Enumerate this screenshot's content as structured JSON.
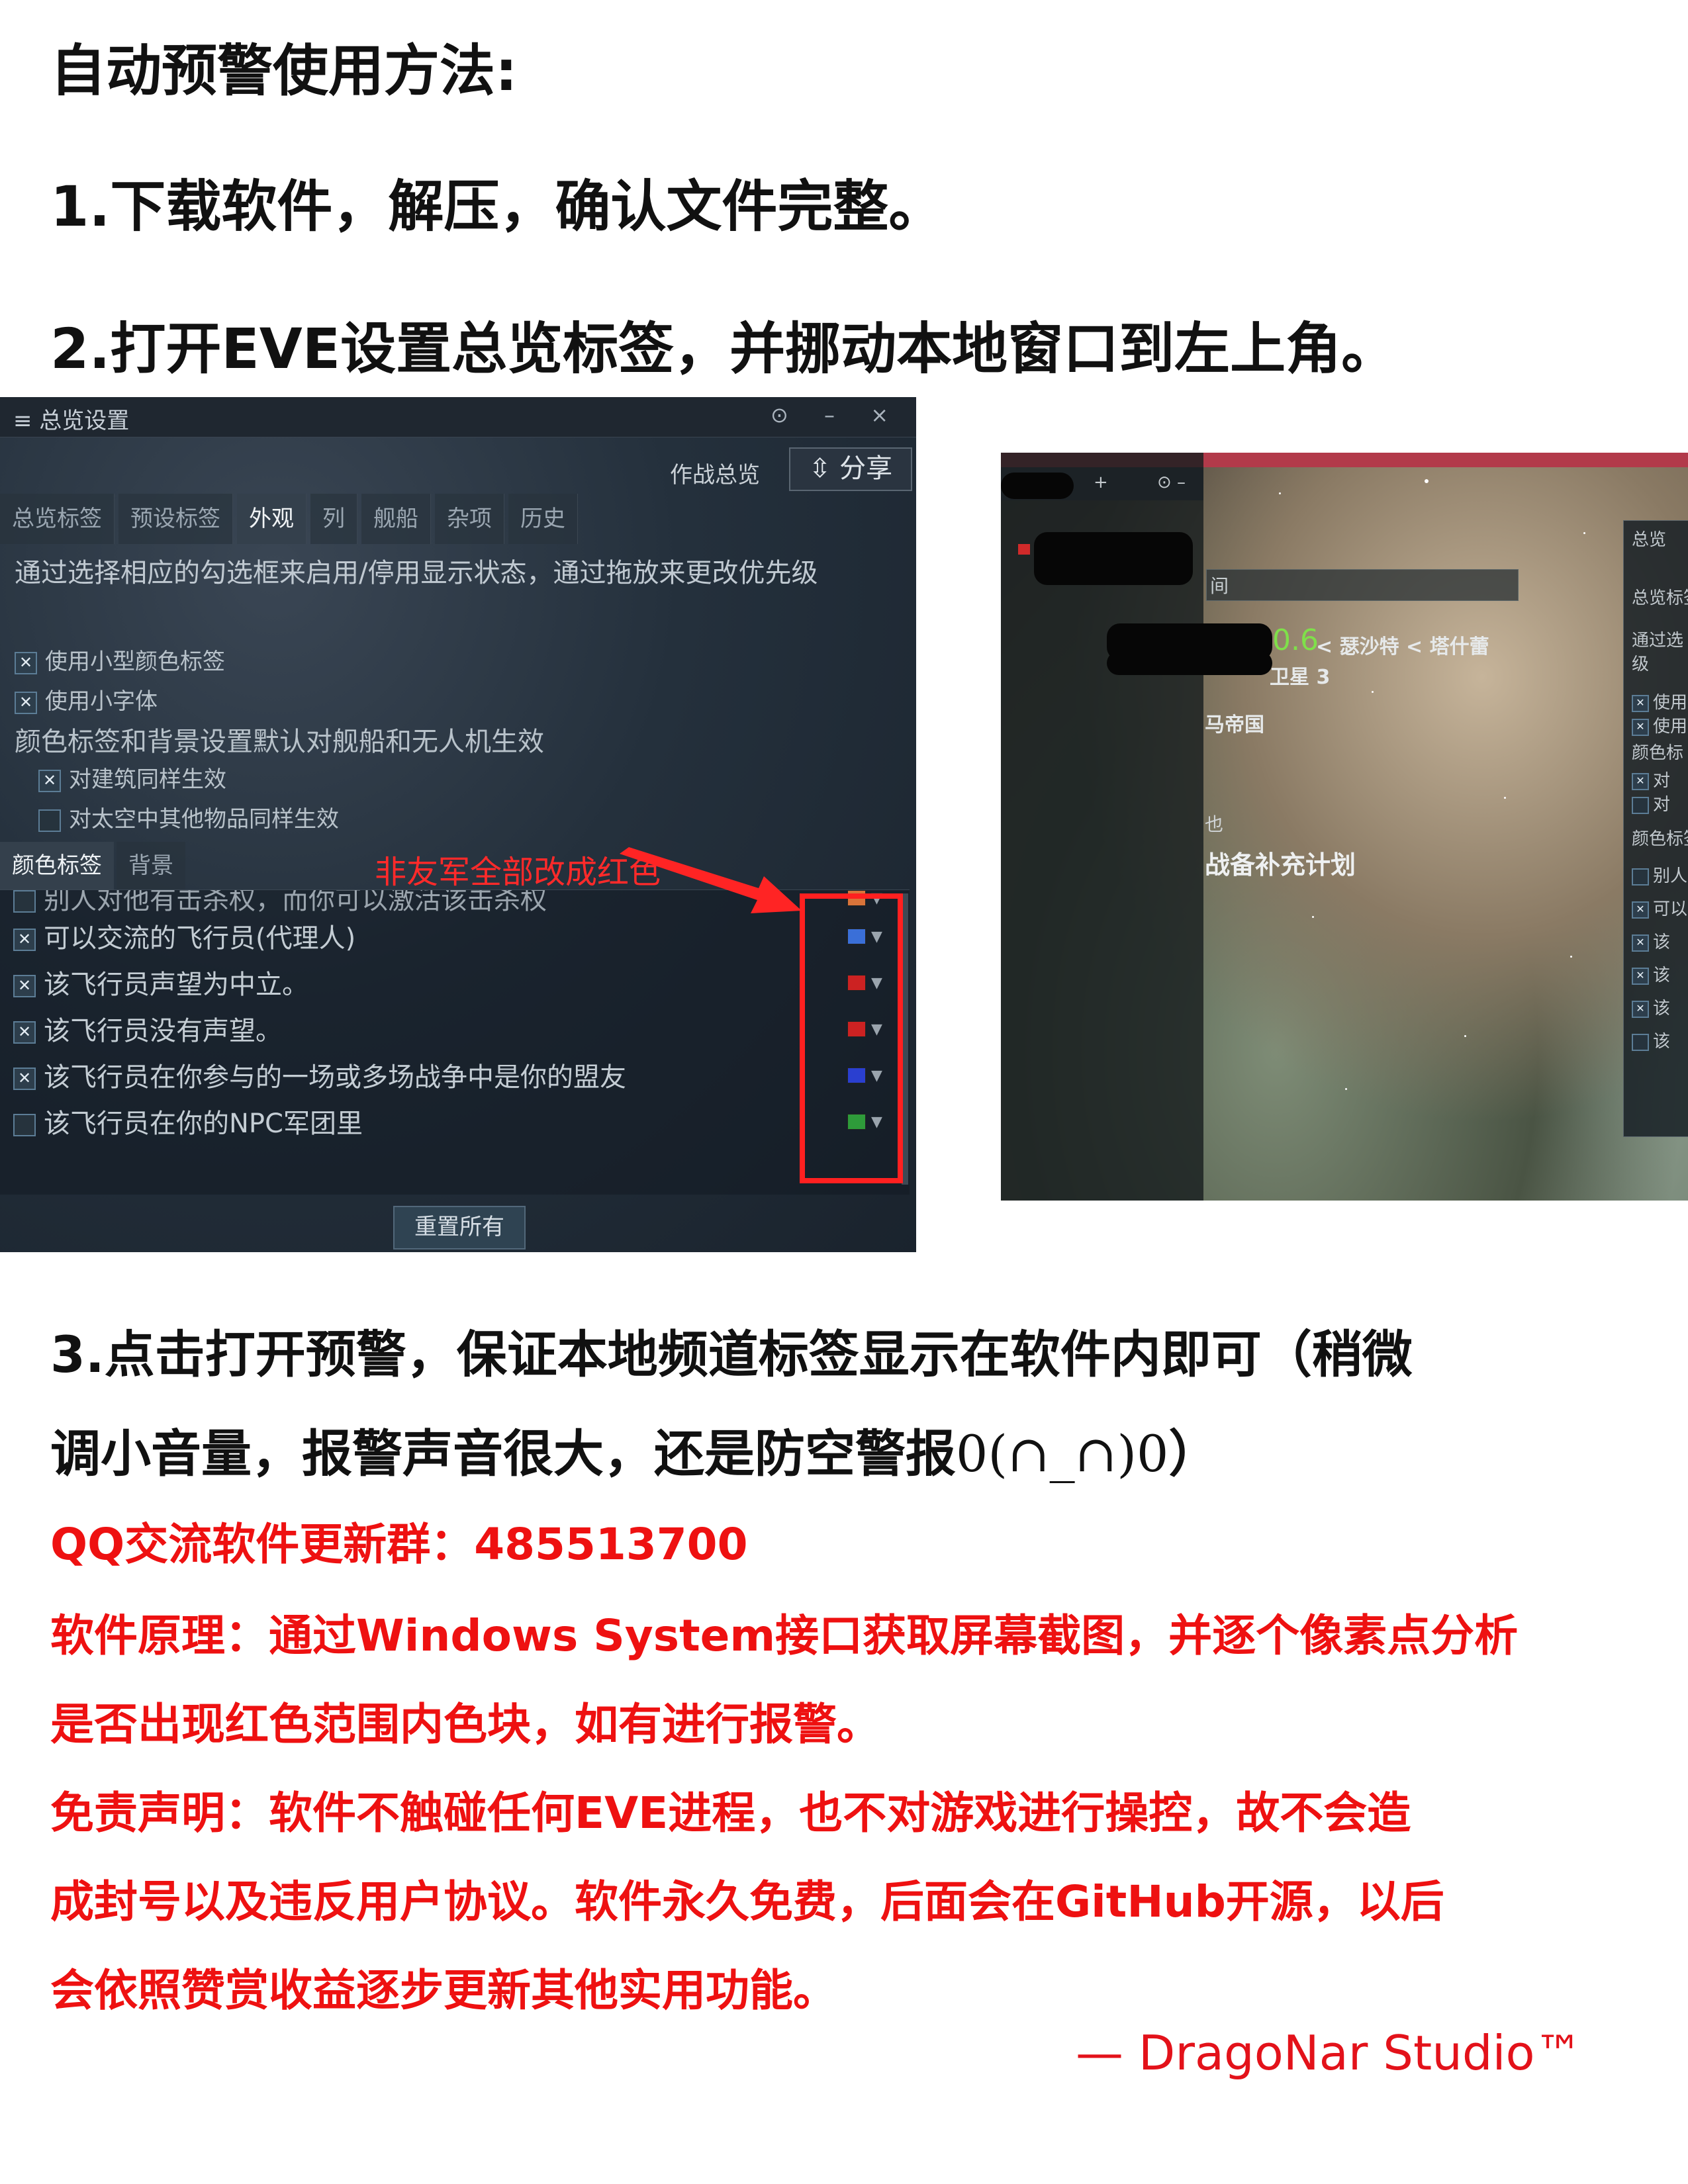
{
  "headings": {
    "title": "自动预警使用方法:",
    "step1": "1.下载软件，解压，确认文件完整。",
    "step2": "2.打开EVE设置总览标签，并挪动本地窗口到左上角。",
    "step3_line1": "3.点击打开预警，保证本地频道标签显示在软件内即可（稍微",
    "step3_line2": "调小音量，报警声音很大，还是防空警报",
    "step3_face": "0(∩_∩)0",
    "step3_end": "）"
  },
  "red_notes": {
    "qq_group": "QQ交流软件更新群：485513700",
    "principle_1": "软件原理：通过Windows System接口获取屏幕截图，并逐个像素点分析",
    "principle_2": "是否出现红色范围内色块，如有进行报警。",
    "disclaimer_1": "免责声明：软件不触碰任何EVE进程，也不对游戏进行操控，故不会造",
    "disclaimer_2": "成封号以及违反用户协议。软件永久免费，后面会在GitHub开源，以后",
    "disclaimer_3": "会依照赞赏收益逐步更新其他实用功能。"
  },
  "signature": "— DragoNar Studio™",
  "overview_window": {
    "title": "≡ 总览设置",
    "title_icons": "⊙ – ×",
    "subbar_label": "作战总览",
    "share_button": "⇳ 分享",
    "tabs": [
      "总览标签",
      "预设标签",
      "外观",
      "列",
      "舰船",
      "杂项",
      "历史"
    ],
    "active_tab": "外观",
    "description": "通过选择相应的勾选框来启用/停用显示状态，通过拖放来更改优先级",
    "option_small_color_tags": "使用小型颜色标签",
    "option_small_font": "使用小字体",
    "color_bg_note": "颜色标签和背景设置默认对舰船和无人机生效",
    "option_structures": "对建筑同样生效",
    "option_space_objects": "对太空中其他物品同样生效",
    "subtabs": [
      "颜色标签",
      "背景"
    ],
    "annotation": "非友军全部改成红色",
    "list_rows": [
      {
        "label": "别人对他有击杀权，而你可以激活该击杀权",
        "checked": false,
        "swatch": "#d9743a"
      },
      {
        "label": "可以交流的飞行员(代理人)",
        "checked": true,
        "swatch": "#3a6fd8"
      },
      {
        "label": "该飞行员声望为中立。",
        "checked": true,
        "swatch": "#cc2222"
      },
      {
        "label": "该飞行员没有声望。",
        "checked": true,
        "swatch": "#cc2222"
      },
      {
        "label": "该飞行员在你参与的一场或多场战争中是你的盟友",
        "checked": true,
        "swatch": "#2a3fd0"
      },
      {
        "label": "该飞行员在你的NPC军团里",
        "checked": false,
        "swatch": "#2e9b3a"
      }
    ],
    "reset_button": "重置所有"
  },
  "game_scene": {
    "plus": "+",
    "controls": "⊙ –",
    "search_text": "间",
    "security": "0.6",
    "route": "< 瑟沙特 < 塔什蕾",
    "moon": "卫星 3",
    "empire": "马帝国",
    "small_label": "也",
    "plan": "战备补充计划",
    "right_window_title": "总览",
    "right_window_lines": [
      "总览标签",
      "通过选",
      "级",
      "使用",
      "使用",
      "颜色标",
      "对",
      "对",
      "颜色标签",
      "别人",
      "可以",
      "该",
      "该",
      "该",
      "该"
    ]
  }
}
